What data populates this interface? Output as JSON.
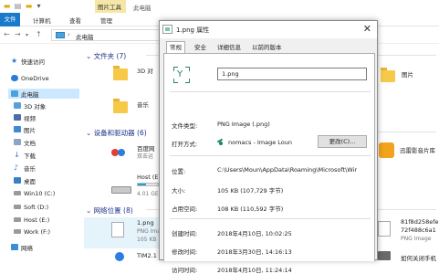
{
  "explorer": {
    "title": "此电脑",
    "tool_tab": "图片工具",
    "ribbon_tabs": [
      "文件",
      "计算机",
      "查看",
      "管理"
    ],
    "address": "此电脑",
    "sidebar": [
      {
        "label": "快速访问",
        "icon": "star-icon"
      },
      {
        "label": "OneDrive",
        "icon": "cloud-icon"
      },
      {
        "label": "此电脑",
        "icon": "computer-icon",
        "selected": true
      },
      {
        "label": "3D 对象",
        "icon": "cube-icon"
      },
      {
        "label": "视频",
        "icon": "video-icon"
      },
      {
        "label": "图片",
        "icon": "picture-icon"
      },
      {
        "label": "文档",
        "icon": "document-icon"
      },
      {
        "label": "下载",
        "icon": "download-icon"
      },
      {
        "label": "音乐",
        "icon": "music-icon"
      },
      {
        "label": "桌面",
        "icon": "desktop-icon"
      },
      {
        "label": "Win10 (C:)",
        "icon": "drive-icon"
      },
      {
        "label": "Soft (D:)",
        "icon": "drive-icon"
      },
      {
        "label": "Host (E:)",
        "icon": "drive-icon"
      },
      {
        "label": "Work (F:)",
        "icon": "drive-icon"
      },
      {
        "label": "网络",
        "icon": "network-icon"
      }
    ],
    "groups": {
      "folders": "文件夹 (7)",
      "devices": "设备和驱动器 (6)",
      "network": "网络位置 (8)"
    },
    "tiles": {
      "objects3d": "3D 对",
      "music": "音乐",
      "pictures": "图片",
      "baidu_label": "百度网",
      "baidu_sub": "双击运",
      "xunlei_label": "迅雷影音片库",
      "host_label": "Host (E",
      "host_sub": "4.01 GE",
      "host_fill": 0.4,
      "png_label": "1.png",
      "png_sub1": "PNG Ima",
      "png_sub2": "105 KB",
      "tim_label": "TIM2.1",
      "hash_label1": "81f8d258efe",
      "hash_label2": "72f488c6a1",
      "hash_sub": "PNG Image",
      "bottom_right": "如何关闭手机"
    }
  },
  "dialog": {
    "title": "1.png 属性",
    "tabs": [
      "常规",
      "安全",
      "详细信息",
      "以前的版本"
    ],
    "filename": "1.png",
    "rows": {
      "type_label": "文件类型:",
      "type_value": "PNG Image (.png)",
      "open_label": "打开方式:",
      "open_value": "nomacs - Image Loun",
      "change_button": "更改(C)...",
      "location_label": "位置:",
      "location_value": "C:\\Users\\Moun\\AppData\\Roaming\\Microsoft\\Wir",
      "size_label": "大小:",
      "size_value": "105 KB (107,729 字节)",
      "disk_label": "占用空间:",
      "disk_value": "108 KB (110,592 字节)",
      "created_label": "创建时间:",
      "created_value": "2018年4月10日, 10:02:25",
      "modified_label": "修改时间:",
      "modified_value": "2018年3月30日, 14:16:13",
      "accessed_label": "访问时间:",
      "accessed_value": "2018年4月10日, 11:24:14"
    }
  }
}
